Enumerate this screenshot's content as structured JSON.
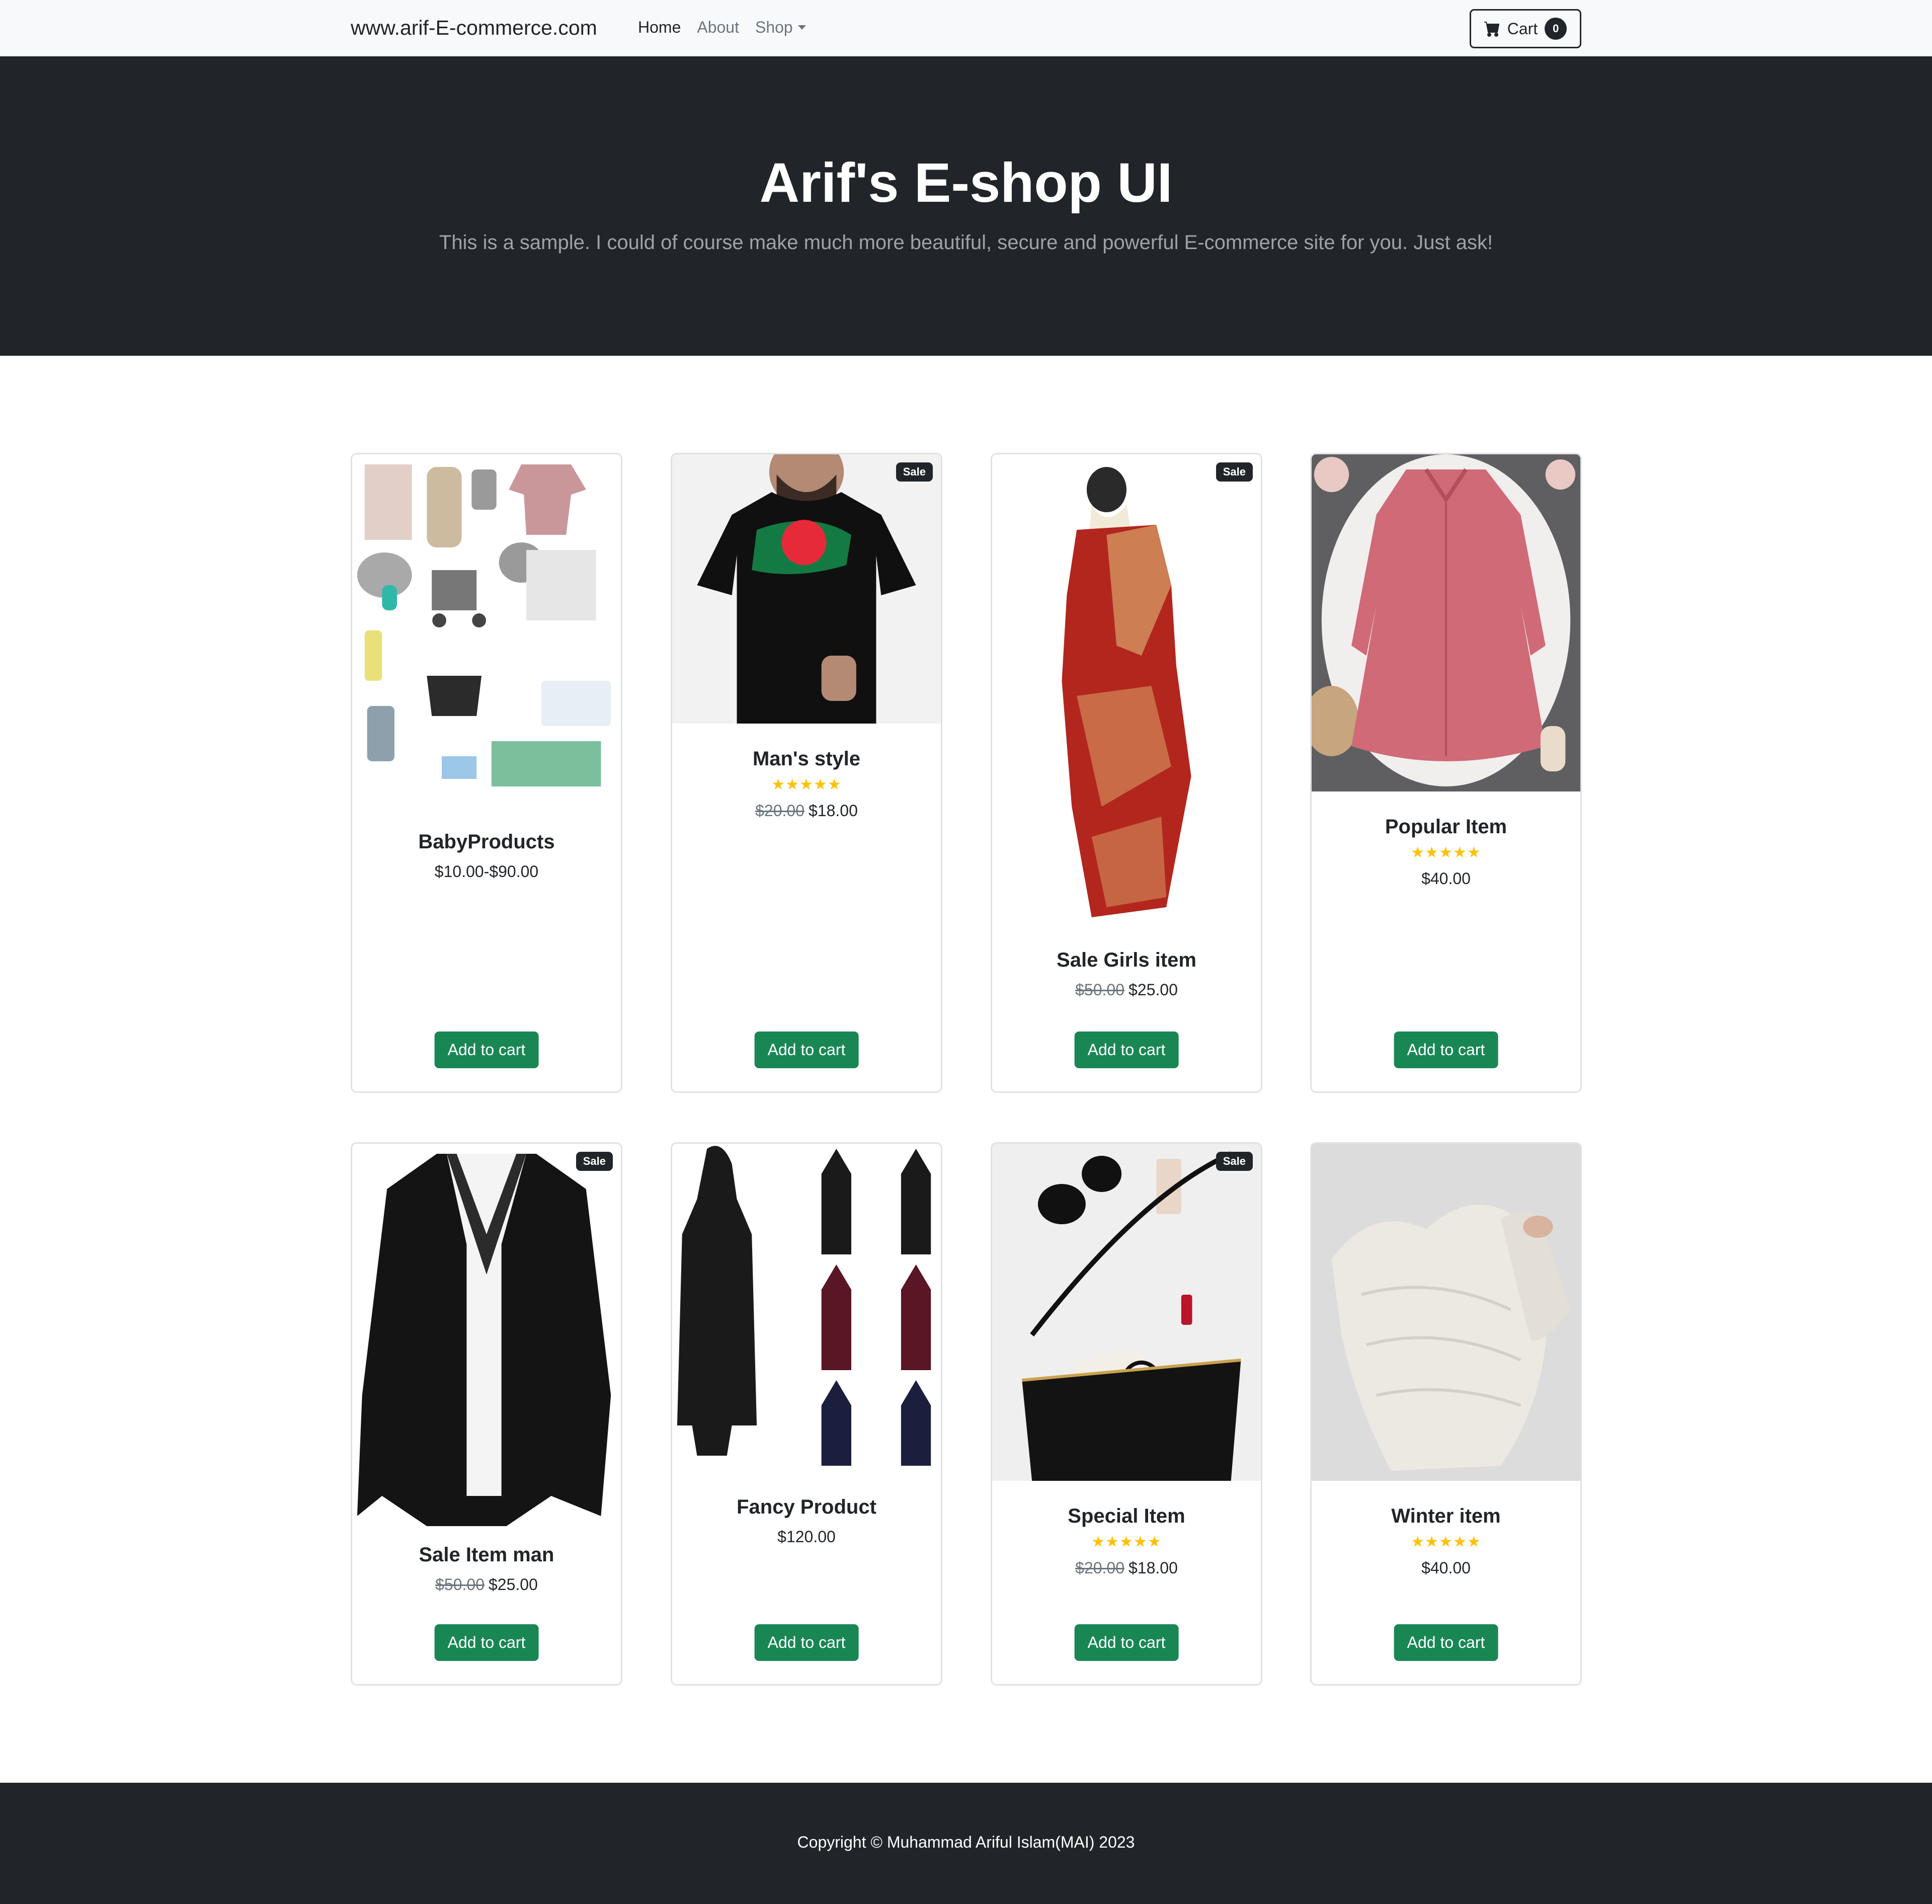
{
  "navbar": {
    "brand": "www.arif-E-commerce.com",
    "links": [
      "Home",
      "About",
      "Shop"
    ],
    "cart_label": "Cart",
    "cart_count": "0"
  },
  "hero": {
    "title": "Arif's E-shop UI",
    "subtitle": "This is a sample. I could of course make much more beautiful, secure and powerful E-commerce site for you. Just ask!"
  },
  "products": [
    {
      "name": "BabyProducts",
      "price": "$10.00-$90.00",
      "button": "Add to cart"
    },
    {
      "name": "Man's style",
      "badge": "Sale",
      "stars": "★★★★★",
      "old_price": "$20.00",
      "price": "$18.00",
      "button": "Add to cart"
    },
    {
      "name": "Sale Girls item",
      "badge": "Sale",
      "old_price": "$50.00",
      "price": "$25.00",
      "button": "Add to cart"
    },
    {
      "name": "Popular Item",
      "stars": "★★★★★",
      "price": "$40.00",
      "button": "Add to cart"
    },
    {
      "name": "Sale Item man",
      "badge": "Sale",
      "old_price": "$50.00",
      "price": "$25.00",
      "button": "Add to cart"
    },
    {
      "name": "Fancy Product",
      "price": "$120.00",
      "button": "Add to cart"
    },
    {
      "name": "Special Item",
      "badge": "Sale",
      "stars": "★★★★★",
      "old_price": "$20.00",
      "price": "$18.00",
      "button": "Add to cart"
    },
    {
      "name": "Winter item",
      "stars": "★★★★★",
      "price": "$40.00",
      "button": "Add to cart"
    }
  ],
  "footer": {
    "copyright": "Copyright © Muhammad Ariful Islam(MAI) 2023"
  },
  "icons": {
    "cart": "shopping-cart-icon",
    "shop_dropdown": "caret-down-icon",
    "rating": "star-icon"
  },
  "colors": {
    "navbar_bg": "#f8f9fa",
    "hero_bg": "#212529",
    "button_green": "#198754",
    "star_yellow": "#ffc107",
    "badge_dark": "#212529"
  }
}
